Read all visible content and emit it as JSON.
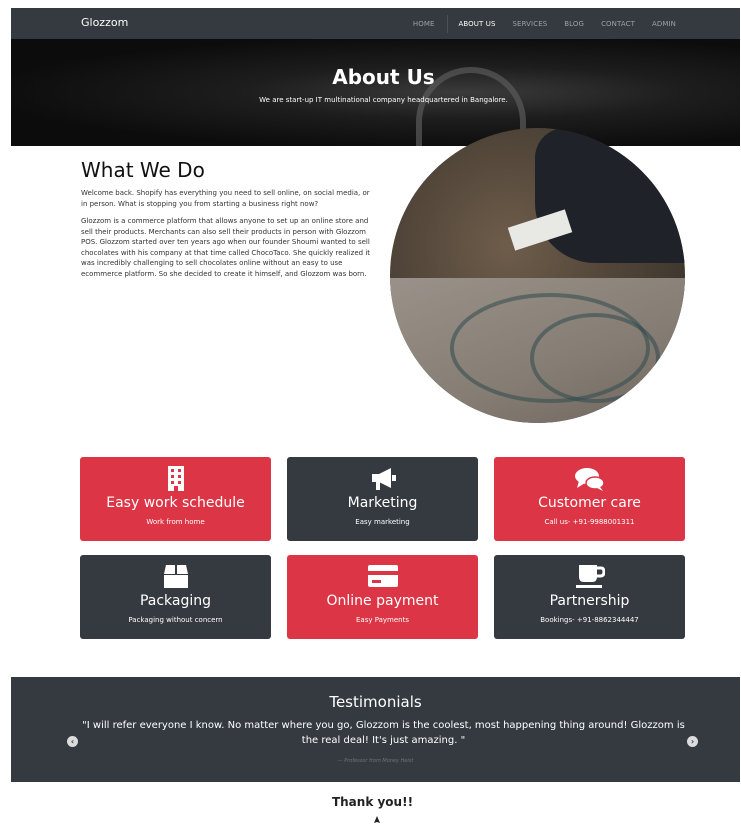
{
  "nav": {
    "brand": "Glozzom",
    "items": [
      {
        "label": "HOME",
        "active": false
      },
      {
        "label": "ABOUT US",
        "active": true
      },
      {
        "label": "SERVICES",
        "active": false
      },
      {
        "label": "BLOG",
        "active": false
      },
      {
        "label": "CONTACT",
        "active": false
      },
      {
        "label": "ADMIN",
        "active": false
      }
    ]
  },
  "hero": {
    "title": "About Us",
    "subtitle": "We are start-up IT multinational company headquartered in Bangalore."
  },
  "about": {
    "heading": "What We Do",
    "paragraph1": "Welcome back. Shopify has everything you need to sell online, on social media, or in person. What is stopping you from starting a business right now?",
    "paragraph2": "Glozzom is a commerce platform that allows anyone to set up an online store and sell their products. Merchants can also sell their products in person with Glozzom POS. Glozzom started over ten years ago when our founder Shoumi wanted to sell chocolates with his company at that time called ChocoTaco. She quickly realized it was incredibly challenging to sell chocolates online without an easy to use ecommerce platform. So she decided to create it himself, and Glozzom was born."
  },
  "cards": [
    {
      "title": "Easy work schedule",
      "subtitle": "Work from home",
      "icon": "building-icon",
      "color": "#dc3545"
    },
    {
      "title": "Marketing",
      "subtitle": "Easy marketing",
      "icon": "bullhorn-icon",
      "color": "#343a40"
    },
    {
      "title": "Customer care",
      "subtitle": "Call us- +91-9988001311",
      "icon": "chat-bubbles-icon",
      "color": "#dc3545"
    },
    {
      "title": "Packaging",
      "subtitle": "Packaging without concern",
      "icon": "box-icon",
      "color": "#343a40"
    },
    {
      "title": "Online payment",
      "subtitle": "Easy Payments",
      "icon": "credit-card-icon",
      "color": "#dc3545"
    },
    {
      "title": "Partnership",
      "subtitle": "Bookings- +91-8862344447",
      "icon": "coffee-cup-icon",
      "color": "#343a40"
    }
  ],
  "testimonials": {
    "heading": "Testimonials",
    "quote": "\"I will refer everyone I know. No matter where you go, Glozzom is the coolest, most happening thing around! Glozzom is the real deal! It's just amazing. \"",
    "author": "— Professor from Money Heist",
    "prev_icon": "chevron-left-icon",
    "next_icon": "chevron-right-icon"
  },
  "footer": {
    "thanks": "Thank you!!"
  }
}
